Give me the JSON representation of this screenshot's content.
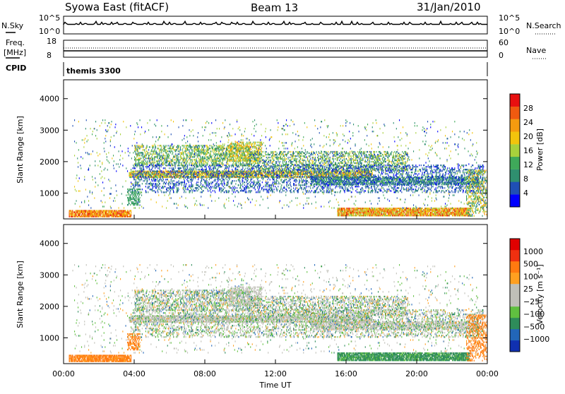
{
  "header": {
    "station": "Syowa East (fitACF)",
    "beam": "Beam 13",
    "date": "31/Jan/2010"
  },
  "nsky_panel": {
    "left_label": "N.Sky",
    "left_ticks": [
      "10^5",
      "10^0"
    ],
    "right_ticks": [
      "10^5",
      "10^0"
    ],
    "right_label": "N.Search"
  },
  "freq_panel": {
    "left_label_1": "Freq.",
    "left_label_2": "[MHz]",
    "left_ticks": [
      "18",
      "8"
    ],
    "right_ticks": [
      "60",
      "0"
    ],
    "right_label": "Nave"
  },
  "cpid_panel": {
    "label": "CPID",
    "program": "themis 3300"
  },
  "colors": {
    "power_scale": [
      "#0000ff",
      "#1f4fb5",
      "#2f8f6f",
      "#3fa95a",
      "#a8d13c",
      "#f2c40c",
      "#f59b0f",
      "#f05a10",
      "#e81010"
    ],
    "velocity_scale": [
      "#1030b0",
      "#2266b8",
      "#2e8c5a",
      "#60c040",
      "#c0c0b8",
      "#c0c0b8",
      "#ffa020",
      "#ff7a10",
      "#f03010",
      "#e00000"
    ]
  },
  "chart_data": [
    {
      "type": "heatmap",
      "name": "power",
      "ylabel": "Slant Range [km]",
      "ylim": [
        180,
        4600
      ],
      "yticks": [
        1000,
        2000,
        3000,
        4000
      ],
      "xlim": [
        0,
        24
      ],
      "colorbar_label": "Power [dB]",
      "colorbar_ticks": [
        "28",
        "24",
        "20",
        "16",
        "12",
        "8",
        "4"
      ],
      "colorbar_range": [
        0,
        32
      ]
    },
    {
      "type": "heatmap",
      "name": "velocity",
      "ylabel": "Slant Range [km]",
      "ylim": [
        180,
        4600
      ],
      "yticks": [
        1000,
        2000,
        3000,
        4000
      ],
      "xlim": [
        0,
        24
      ],
      "xlabel": "Time UT",
      "xticks": [
        "00:00",
        "04:00",
        "08:00",
        "12:00",
        "16:00",
        "20:00",
        "00:00"
      ],
      "colorbar_label": "Velocity [m s⁻¹]",
      "colorbar_ticks": [
        "1000",
        "500",
        "100",
        "25",
        "−25",
        "−100",
        "−500",
        "−1000"
      ]
    }
  ]
}
